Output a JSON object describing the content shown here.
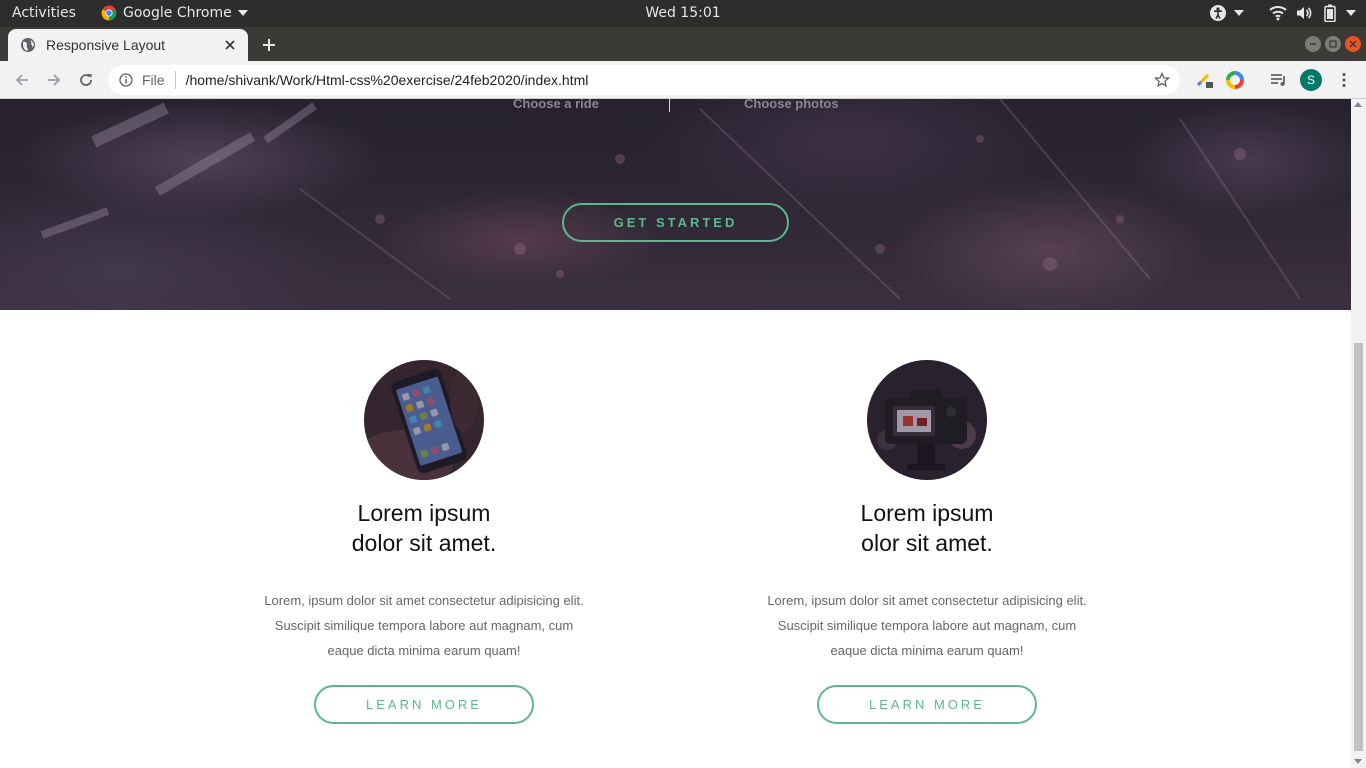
{
  "system_bar": {
    "activities": "Activities",
    "app_name": "Google Chrome",
    "clock": "Wed 15:01"
  },
  "browser": {
    "tab_title": "Responsive Layout",
    "url_scheme": "File",
    "url": "/home/shivank/Work/Html-css%20exercise/24feb2020/index.html",
    "profile_initial": "S"
  },
  "hero": {
    "choices": [
      "Choose a ride",
      "Choose photos"
    ],
    "cta_label": "GET STARTED"
  },
  "features": [
    {
      "title_line1": "Lorem ipsum",
      "title_line2": "dolor sit amet.",
      "body": "Lorem, ipsum dolor sit amet consectetur adipisicing elit. Suscipit similique tempora labore aut magnam, cum eaque dicta minima earum quam!",
      "button": "LEARN MORE",
      "image": "phone-in-hand"
    },
    {
      "title_line1": "Lorem ipsum",
      "title_line2": "olor sit amet.",
      "body": "Lorem, ipsum dolor sit amet consectetur adipisicing elit. Suscipit similique tempora labore aut magnam, cum eaque dicta minima earum quam!",
      "button": "LEARN MORE",
      "image": "camera-on-tripod"
    }
  ],
  "colors": {
    "accent": "#5fb68c",
    "hero_bg": "#2e2735",
    "ubuntu_orange": "#e95420",
    "topbar": "#2d2d2d"
  }
}
